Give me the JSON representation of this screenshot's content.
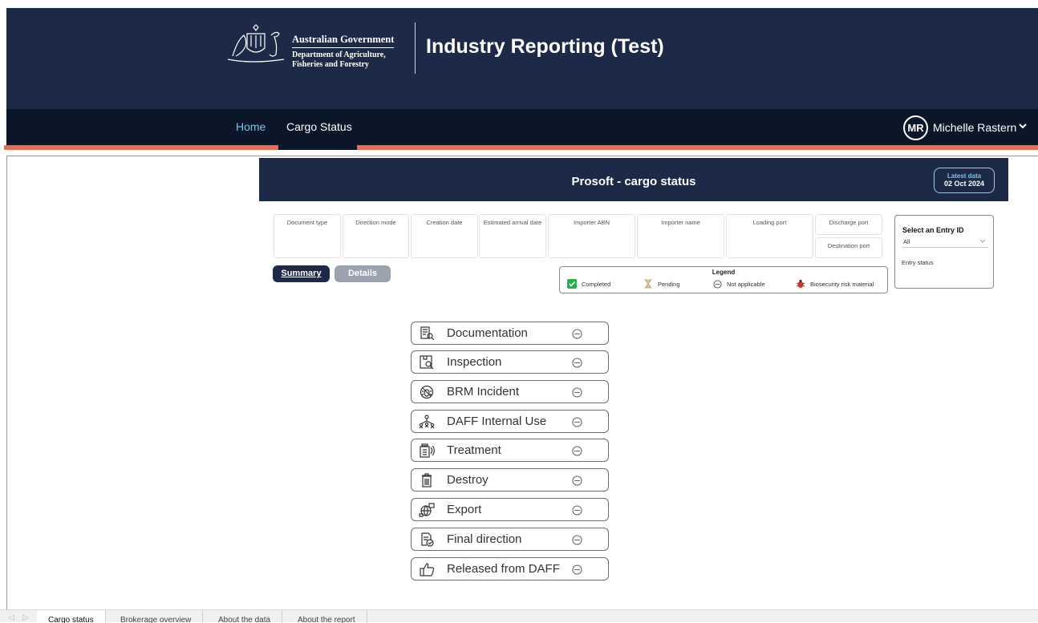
{
  "header": {
    "gov_title": "Australian Government",
    "dept_line1": "Department of Agriculture,",
    "dept_line2": "Fisheries and Forestry",
    "app_title": "Industry Reporting (Test)"
  },
  "nav": {
    "items": [
      {
        "label": "Home"
      },
      {
        "label": "Cargo Status"
      }
    ],
    "user": {
      "initials": "MR",
      "name": "Michelle Rastern"
    }
  },
  "report": {
    "title": "Prosoft - cargo status",
    "latest_label": "Latest data",
    "latest_date": "02 Oct 2024"
  },
  "filters": [
    "Document type",
    "Direction mode",
    "Creation date",
    "Estimated arrival date",
    "Importer ABN",
    "Importer name",
    "Loading port",
    "Discharge port",
    "Destination port"
  ],
  "entry": {
    "title": "Select an Entry ID",
    "selected": "All",
    "status_label": "Entry status"
  },
  "buttons": {
    "summary": "Summary",
    "details": "Details"
  },
  "legend": {
    "title": "Legend",
    "items": [
      {
        "label": "Completed",
        "icon": "check-icon",
        "color": "#22b14c"
      },
      {
        "label": "Pending",
        "icon": "hourglass-icon",
        "color": "#b8a06a"
      },
      {
        "label": "Not applicable",
        "icon": "minus-circle-icon",
        "color": "#555555"
      },
      {
        "label": "Biosecurity risk material",
        "icon": "bug-icon",
        "color": "#c0392b"
      }
    ]
  },
  "steps": [
    {
      "label": "Documentation",
      "icon": "documentation-icon",
      "status": "not-applicable"
    },
    {
      "label": "Inspection",
      "icon": "inspection-icon",
      "status": "not-applicable"
    },
    {
      "label": "BRM Incident",
      "icon": "brm-incident-icon",
      "status": "not-applicable"
    },
    {
      "label": "DAFF Internal Use",
      "icon": "internal-use-icon",
      "status": "not-applicable"
    },
    {
      "label": "Treatment",
      "icon": "treatment-icon",
      "status": "not-applicable"
    },
    {
      "label": "Destroy",
      "icon": "trash-icon",
      "status": "not-applicable"
    },
    {
      "label": "Export",
      "icon": "export-icon",
      "status": "not-applicable"
    },
    {
      "label": "Final direction",
      "icon": "final-direction-icon",
      "status": "not-applicable"
    },
    {
      "label": "Released from DAFF",
      "icon": "thumbs-up-icon",
      "status": "not-applicable"
    }
  ],
  "page_tabs": [
    {
      "label": "Cargo status",
      "active": true
    },
    {
      "label": "Brokerage overview",
      "active": false
    },
    {
      "label": "About the data",
      "active": false
    },
    {
      "label": "About the report",
      "active": false
    }
  ]
}
